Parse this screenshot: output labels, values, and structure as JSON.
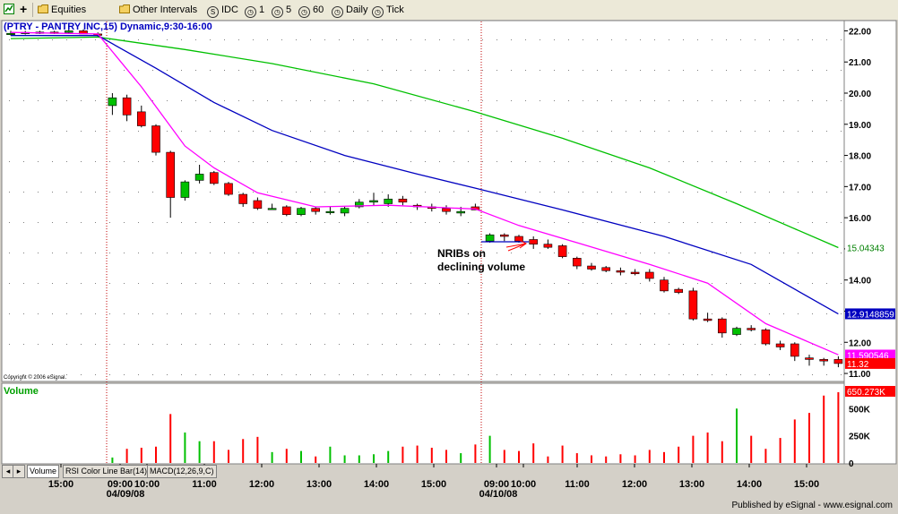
{
  "toolbar": {
    "equities": "Equities",
    "other_intervals": "Other Intervals",
    "idc": "IDC",
    "i1": "1",
    "i5": "5",
    "i60": "60",
    "daily": "Daily",
    "tick": "Tick"
  },
  "chart_title": "(PTRY - PANTRY INC,15) Dynamic,9:30-16:00",
  "copyright": "Copyright © 2006 eSignal.",
  "annotation": {
    "line1": "NRIBs on",
    "line2": "declining volume"
  },
  "volume_label": "Volume",
  "tabs": [
    "Volume",
    "RSI Color Line Bar(14)",
    "MACD(12,26,9,C)"
  ],
  "footer": "Published by eSignal - www.esignal.com",
  "colors": {
    "up": "#00c000",
    "down": "#ff0000",
    "ma_fast": "#ff00ff",
    "ma_mid": "#0000c0",
    "ma_slow": "#00c000"
  },
  "chart_data": {
    "type": "candlestick",
    "price_axis": {
      "min": 10.8,
      "max": 22.3,
      "ticks": [
        "22.00",
        "21.00",
        "20.00",
        "19.00",
        "18.00",
        "17.00",
        "16.00",
        "15.00",
        "14.00",
        "13.00",
        "12.00",
        "11.00"
      ]
    },
    "volume_axis": {
      "max": 700000,
      "ticks": [
        "500K",
        "250K",
        "0"
      ]
    },
    "time_labels": [
      "15:00",
      "09:00",
      "10:00",
      "11:00",
      "12:00",
      "13:00",
      "14:00",
      "15:00",
      "09:00",
      "10:00",
      "11:00",
      "12:00",
      "13:00",
      "14:00",
      "15:00"
    ],
    "date_labels": [
      "04/09/08",
      "04/10/08"
    ],
    "last_values": {
      "ma_slow": "15.04343",
      "ma_mid": "12.9148859",
      "ma_fast": "11.590546",
      "price": "11.32",
      "volume": "650.273K"
    },
    "candles": [
      {
        "o": 21.9,
        "h": 22.0,
        "l": 21.85,
        "c": 21.92,
        "v": 0
      },
      {
        "o": 21.92,
        "h": 22.0,
        "l": 21.88,
        "c": 21.95,
        "v": 0
      },
      {
        "o": 21.95,
        "h": 22.0,
        "l": 21.9,
        "c": 21.96,
        "v": 0
      },
      {
        "o": 21.96,
        "h": 22.0,
        "l": 21.9,
        "c": 21.95,
        "v": 0
      },
      {
        "o": 21.95,
        "h": 22.05,
        "l": 21.9,
        "c": 22.0,
        "v": 0
      },
      {
        "o": 22.0,
        "h": 22.05,
        "l": 21.9,
        "c": 21.9,
        "v": 0
      },
      {
        "o": 21.9,
        "h": 21.95,
        "l": 21.8,
        "c": 21.88,
        "v": 0
      },
      {
        "o": 19.6,
        "h": 20.0,
        "l": 19.3,
        "c": 19.85,
        "v": 50000
      },
      {
        "o": 19.85,
        "h": 19.95,
        "l": 19.1,
        "c": 19.3,
        "v": 130000
      },
      {
        "o": 19.4,
        "h": 19.6,
        "l": 18.9,
        "c": 18.95,
        "v": 140000
      },
      {
        "o": 18.95,
        "h": 19.0,
        "l": 18.0,
        "c": 18.1,
        "v": 150000
      },
      {
        "o": 18.1,
        "h": 18.15,
        "l": 16.0,
        "c": 16.65,
        "v": 450000
      },
      {
        "o": 16.65,
        "h": 17.2,
        "l": 16.55,
        "c": 17.15,
        "v": 280000
      },
      {
        "o": 17.2,
        "h": 17.7,
        "l": 17.1,
        "c": 17.4,
        "v": 200000
      },
      {
        "o": 17.45,
        "h": 17.5,
        "l": 17.05,
        "c": 17.1,
        "v": 200000
      },
      {
        "o": 17.1,
        "h": 17.15,
        "l": 16.7,
        "c": 16.75,
        "v": 120000
      },
      {
        "o": 16.75,
        "h": 16.8,
        "l": 16.35,
        "c": 16.45,
        "v": 220000
      },
      {
        "o": 16.55,
        "h": 16.65,
        "l": 16.25,
        "c": 16.3,
        "v": 240000
      },
      {
        "o": 16.3,
        "h": 16.45,
        "l": 16.25,
        "c": 16.3,
        "v": 100000
      },
      {
        "o": 16.35,
        "h": 16.4,
        "l": 16.05,
        "c": 16.1,
        "v": 130000
      },
      {
        "o": 16.1,
        "h": 16.35,
        "l": 16.05,
        "c": 16.3,
        "v": 110000
      },
      {
        "o": 16.3,
        "h": 16.35,
        "l": 16.1,
        "c": 16.2,
        "v": 60000
      },
      {
        "o": 16.2,
        "h": 16.35,
        "l": 16.1,
        "c": 16.2,
        "v": 150000
      },
      {
        "o": 16.15,
        "h": 16.35,
        "l": 16.05,
        "c": 16.3,
        "v": 70000
      },
      {
        "o": 16.35,
        "h": 16.6,
        "l": 16.3,
        "c": 16.5,
        "v": 70000
      },
      {
        "o": 16.5,
        "h": 16.8,
        "l": 16.4,
        "c": 16.55,
        "v": 80000
      },
      {
        "o": 16.45,
        "h": 16.75,
        "l": 16.35,
        "c": 16.6,
        "v": 110000
      },
      {
        "o": 16.6,
        "h": 16.7,
        "l": 16.4,
        "c": 16.5,
        "v": 150000
      },
      {
        "o": 16.4,
        "h": 16.45,
        "l": 16.25,
        "c": 16.35,
        "v": 160000
      },
      {
        "o": 16.35,
        "h": 16.45,
        "l": 16.2,
        "c": 16.3,
        "v": 140000
      },
      {
        "o": 16.3,
        "h": 16.4,
        "l": 16.1,
        "c": 16.2,
        "v": 120000
      },
      {
        "o": 16.15,
        "h": 16.35,
        "l": 16.05,
        "c": 16.2,
        "v": 90000
      },
      {
        "o": 16.35,
        "h": 16.45,
        "l": 16.25,
        "c": 16.25,
        "v": 170000
      },
      {
        "o": 15.25,
        "h": 15.5,
        "l": 15.2,
        "c": 15.45,
        "v": 250000
      },
      {
        "o": 15.45,
        "h": 15.5,
        "l": 15.25,
        "c": 15.4,
        "v": 120000
      },
      {
        "o": 15.4,
        "h": 15.45,
        "l": 15.2,
        "c": 15.25,
        "v": 110000
      },
      {
        "o": 15.3,
        "h": 15.4,
        "l": 15.0,
        "c": 15.15,
        "v": 180000
      },
      {
        "o": 15.15,
        "h": 15.3,
        "l": 15.0,
        "c": 15.05,
        "v": 60000
      },
      {
        "o": 15.1,
        "h": 15.15,
        "l": 14.7,
        "c": 14.75,
        "v": 160000
      },
      {
        "o": 14.7,
        "h": 14.75,
        "l": 14.35,
        "c": 14.45,
        "v": 90000
      },
      {
        "o": 14.45,
        "h": 14.55,
        "l": 14.3,
        "c": 14.35,
        "v": 70000
      },
      {
        "o": 14.4,
        "h": 14.45,
        "l": 14.25,
        "c": 14.3,
        "v": 60000
      },
      {
        "o": 14.3,
        "h": 14.4,
        "l": 14.15,
        "c": 14.25,
        "v": 80000
      },
      {
        "o": 14.25,
        "h": 14.35,
        "l": 14.15,
        "c": 14.2,
        "v": 70000
      },
      {
        "o": 14.25,
        "h": 14.35,
        "l": 13.95,
        "c": 14.05,
        "v": 120000
      },
      {
        "o": 14.0,
        "h": 14.1,
        "l": 13.6,
        "c": 13.65,
        "v": 100000
      },
      {
        "o": 13.7,
        "h": 13.75,
        "l": 13.55,
        "c": 13.6,
        "v": 150000
      },
      {
        "o": 13.65,
        "h": 13.75,
        "l": 12.7,
        "c": 12.75,
        "v": 250000
      },
      {
        "o": 12.75,
        "h": 12.95,
        "l": 12.65,
        "c": 12.7,
        "v": 280000
      },
      {
        "o": 12.75,
        "h": 12.8,
        "l": 12.15,
        "c": 12.3,
        "v": 200000
      },
      {
        "o": 12.25,
        "h": 12.5,
        "l": 12.2,
        "c": 12.45,
        "v": 500000
      },
      {
        "o": 12.45,
        "h": 12.55,
        "l": 12.35,
        "c": 12.4,
        "v": 250000
      },
      {
        "o": 12.4,
        "h": 12.45,
        "l": 11.9,
        "c": 11.95,
        "v": 130000
      },
      {
        "o": 11.95,
        "h": 12.05,
        "l": 11.75,
        "c": 11.85,
        "v": 230000
      },
      {
        "o": 11.95,
        "h": 12.0,
        "l": 11.4,
        "c": 11.55,
        "v": 400000
      },
      {
        "o": 11.5,
        "h": 11.6,
        "l": 11.25,
        "c": 11.45,
        "v": 460000
      },
      {
        "o": 11.45,
        "h": 11.5,
        "l": 11.25,
        "c": 11.4,
        "v": 620000
      },
      {
        "o": 11.45,
        "h": 11.55,
        "l": 11.2,
        "c": 11.32,
        "v": 650273
      }
    ],
    "ma_fast": [
      [
        0,
        21.95
      ],
      [
        6,
        21.9
      ],
      [
        9,
        20.2
      ],
      [
        12,
        18.3
      ],
      [
        14,
        17.6
      ],
      [
        17,
        16.8
      ],
      [
        21,
        16.35
      ],
      [
        26,
        16.4
      ],
      [
        32,
        16.28
      ],
      [
        35,
        15.75
      ],
      [
        39,
        15.2
      ],
      [
        44,
        14.5
      ],
      [
        48,
        13.9
      ],
      [
        52,
        12.6
      ],
      [
        57,
        11.6
      ]
    ],
    "ma_mid": [
      [
        0,
        21.85
      ],
      [
        6,
        21.85
      ],
      [
        10,
        20.8
      ],
      [
        14,
        19.7
      ],
      [
        18,
        18.8
      ],
      [
        23,
        18.0
      ],
      [
        28,
        17.4
      ],
      [
        32,
        16.95
      ],
      [
        38,
        16.25
      ],
      [
        45,
        15.4
      ],
      [
        51,
        14.5
      ],
      [
        57,
        12.91
      ]
    ],
    "ma_slow": [
      [
        0,
        21.75
      ],
      [
        6,
        21.8
      ],
      [
        12,
        21.4
      ],
      [
        18,
        20.95
      ],
      [
        25,
        20.3
      ],
      [
        32,
        19.4
      ],
      [
        38,
        18.55
      ],
      [
        44,
        17.6
      ],
      [
        50,
        16.45
      ],
      [
        57,
        15.04
      ]
    ]
  }
}
